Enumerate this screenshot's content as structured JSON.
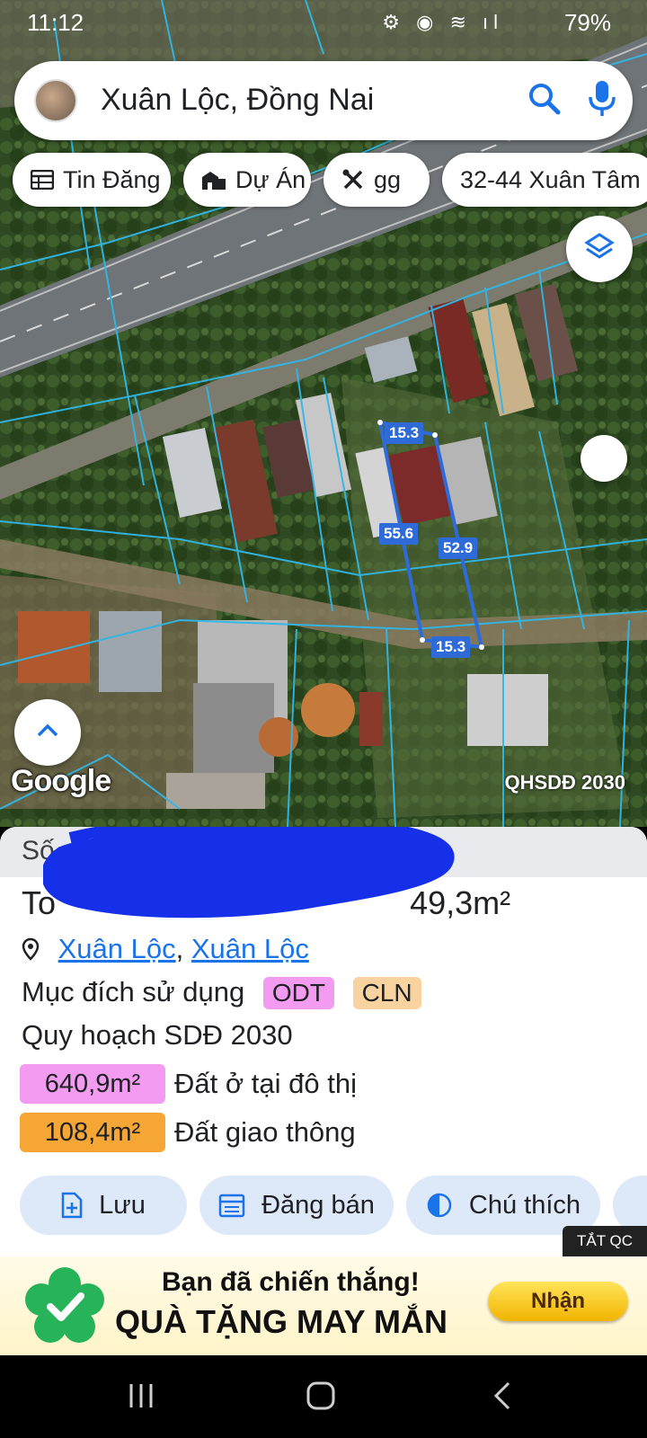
{
  "status_bar": {
    "time": "11:12",
    "battery": "79%"
  },
  "search": {
    "query": "Xuân Lộc, Đồng Nai"
  },
  "chips": [
    {
      "label": "Tin Đăng",
      "icon": "table-icon"
    },
    {
      "label": "Dự Án",
      "icon": "building-icon"
    },
    {
      "label": "gg",
      "icon": "tools-icon"
    },
    {
      "label": "32-44 Xuân Tâm",
      "icon": ""
    }
  ],
  "map": {
    "plot_dimensions": [
      "15.3",
      "55.6",
      "52.9",
      "15.3"
    ],
    "provider": "Google",
    "layer_tag": "QHSDĐ 2030"
  },
  "panel": {
    "header": "Số c",
    "area_prefix": "To",
    "area_value": "49,3m²",
    "location": {
      "commune": "Xuân Lộc",
      "district": "Xuân Lộc"
    },
    "purpose_label": "Mục đích sử dụng",
    "purpose_tags": [
      "ODT",
      "CLN"
    ],
    "planning_label": "Quy hoạch SDĐ 2030",
    "land_uses": [
      {
        "area": "640,9m²",
        "label": "Đất ở tại đô thị",
        "color": "#f39bf0"
      },
      {
        "area": "108,4m²",
        "label": "Đất giao thông",
        "color": "#f6a634"
      }
    ],
    "actions": [
      {
        "label": "Lưu",
        "icon": "add-file-icon"
      },
      {
        "label": "Đăng bán",
        "icon": "calendar-icon"
      },
      {
        "label": "Chú thích",
        "icon": "half-circle-icon"
      }
    ]
  },
  "ad": {
    "close_label": "TẮT QC",
    "line1": "Bạn đã chiến thắng!",
    "line2": "QUÀ TẶNG MAY MẮN",
    "button": "Nhận"
  },
  "colors": {
    "accent": "#1a73e8",
    "parcel_line": "#2fb7e8",
    "plot_outline": "#2f6bd8"
  }
}
